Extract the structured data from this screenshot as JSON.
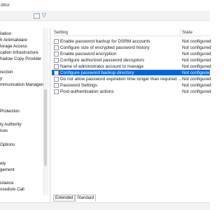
{
  "window": {
    "title": "ditor"
  },
  "toolbar": {
    "filter_icon": "filter-icon"
  },
  "tree": {
    "items": [
      "ilation",
      "h Antimalware",
      "torage Access",
      "cation Infrastructure",
      "hadow Copy Provider",
      "rection",
      "y",
      "mmunication Managen",
      "Protection",
      "ty Authority",
      "ices",
      "Options",
      "ety",
      "gement",
      "istance",
      "ocedure Call"
    ]
  },
  "list": {
    "header": {
      "setting": "Setting",
      "state": "State"
    },
    "rows": [
      {
        "name": "Enable password backup for DSRM accounts",
        "state": "Not configured"
      },
      {
        "name": "Configure size of encrypted password history",
        "state": "Not configured"
      },
      {
        "name": "Enable password encryption",
        "state": "Not configured"
      },
      {
        "name": "Configure authorized password decryptors",
        "state": "Not configured"
      },
      {
        "name": "Name of administrator account to manage",
        "state": "Not configured"
      },
      {
        "name": "Configure password backup directory",
        "state": "Not configured"
      },
      {
        "name": "Do not allow password expiration time longer than required ...",
        "state": "Not configured"
      },
      {
        "name": "Password Settings",
        "state": "Not configured"
      },
      {
        "name": "Post-authentication actions",
        "state": "Not configured"
      }
    ]
  },
  "tabs": {
    "extended": "Extended",
    "standard": "Standard"
  }
}
